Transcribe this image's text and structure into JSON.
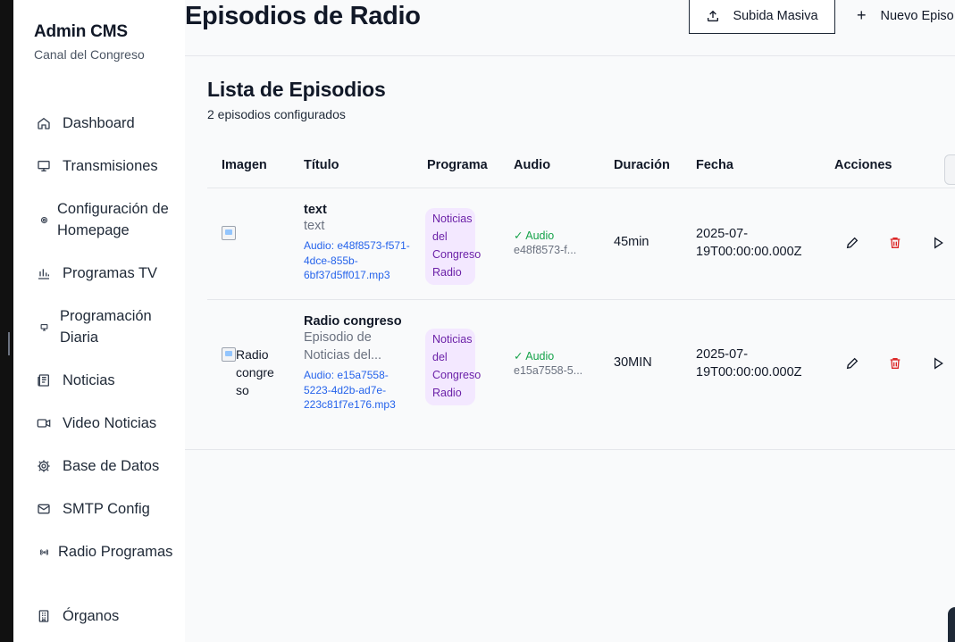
{
  "brand": {
    "title": "Admin CMS",
    "subtitle": "Canal del Congreso"
  },
  "nav": [
    {
      "label": "Dashboard",
      "icon": "home-icon"
    },
    {
      "label": "Transmisiones",
      "icon": "monitor-icon"
    },
    {
      "label": "Configuración de Homepage",
      "icon": "settings-dot-icon"
    },
    {
      "label": "Programas TV",
      "icon": "bar-chart-icon"
    },
    {
      "label": "Programación Diaria",
      "icon": "small-monitor-icon"
    },
    {
      "label": "Noticias",
      "icon": "newspaper-icon"
    },
    {
      "label": "Video Noticias",
      "icon": "video-icon"
    },
    {
      "label": "Base de Datos",
      "icon": "gear-icon"
    },
    {
      "label": "SMTP Config",
      "icon": "mail-icon"
    },
    {
      "label": "Radio Programas",
      "icon": "radio-icon"
    },
    {
      "label": "Órganos",
      "icon": "building-icon"
    }
  ],
  "header": {
    "title": "Episodios de Radio",
    "upload_label": "Subida Masiva",
    "new_label": "Nuevo Episo"
  },
  "card": {
    "title": "Lista de Episodios",
    "subtitle": "2 episodios configurados"
  },
  "table": {
    "columns": [
      "Imagen",
      "Título",
      "Programa",
      "Audio",
      "Duración",
      "Fecha",
      "Acciones"
    ],
    "rows": [
      {
        "image_alt": "",
        "title": "text",
        "description": "text",
        "audio_file": "Audio: e48f8573-f571-4dce-855b-6bf37d5ff017.mp3",
        "program": "Noticias del Congreso Radio",
        "audio_status": "✓ Audio",
        "audio_id": "e48f8573-f...",
        "duration": "45min",
        "date": "2025-07-19T00:00:00.000Z"
      },
      {
        "image_alt": "Radio congreso",
        "title": "Radio congreso",
        "description": "Episodio de Noticias del...",
        "audio_file": "Audio: e15a7558-5223-4d2b-ad7e-223c81f7e176.mp3",
        "program": "Noticias del Congreso Radio",
        "audio_status": "✓ Audio",
        "audio_id": "e15a7558-5...",
        "duration": "30MIN",
        "date": "2025-07-19T00:00:00.000Z"
      }
    ]
  },
  "colors": {
    "accent_link": "#2563eb",
    "badge_bg": "#f3e8ff",
    "badge_text": "#6b21a8",
    "success": "#16a34a",
    "delete": "#dc2626"
  }
}
